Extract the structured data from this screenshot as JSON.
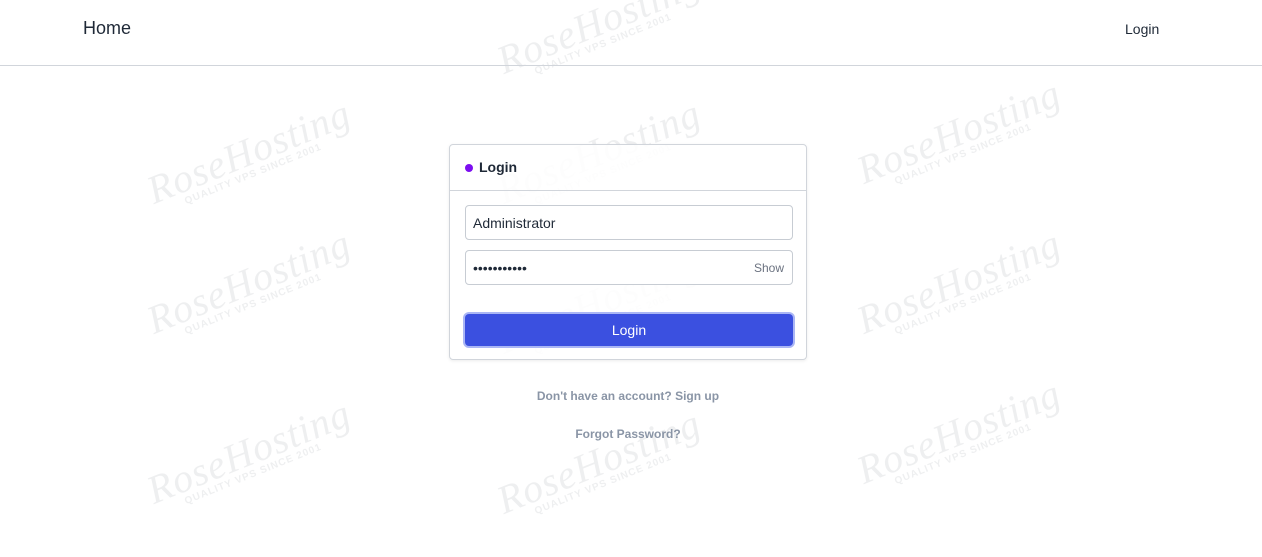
{
  "navbar": {
    "home_label": "Home",
    "login_label": "Login"
  },
  "login_card": {
    "title": "Login",
    "accent_color": "#7c0ef0",
    "username_value": "Administrator",
    "password_value": "•••••••••••",
    "show_label": "Show",
    "submit_label": "Login",
    "button_color": "#3b50e0"
  },
  "links": {
    "signup": "Don't have an account? Sign up",
    "forgot_password": "Forgot Password?"
  },
  "watermark": {
    "brand": "RoseHosting",
    "tagline": "QUALITY VPS SINCE 2001"
  }
}
